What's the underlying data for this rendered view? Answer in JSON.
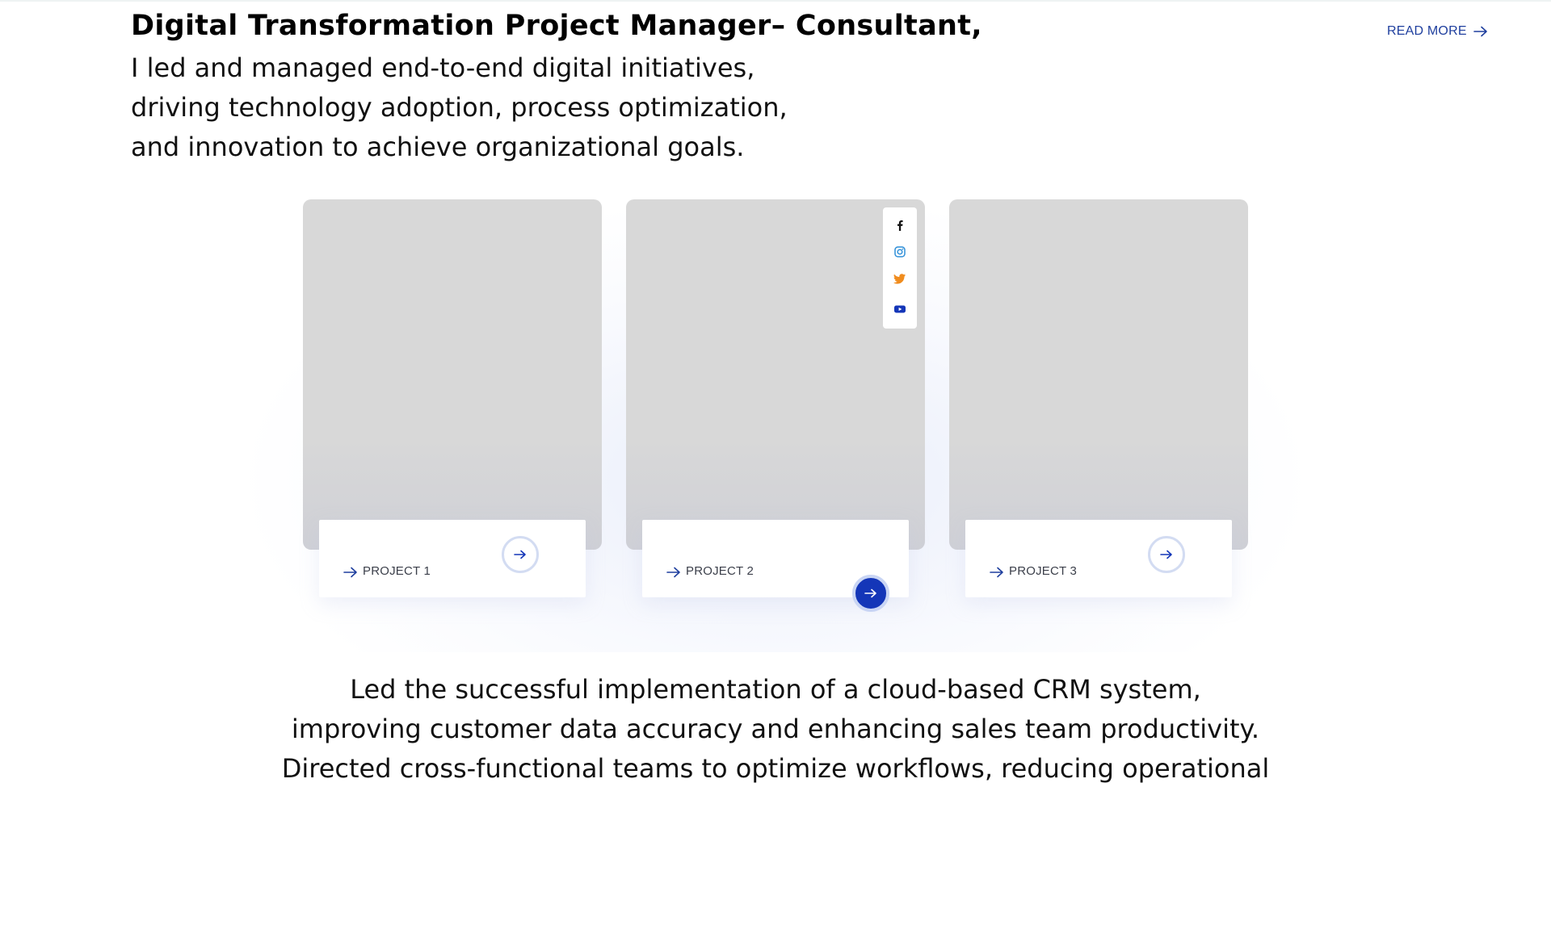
{
  "intro": {
    "title": "Digital Transformation Project Manager– Consultant,",
    "lines": [
      "I led and managed end-to-end digital initiatives,",
      "driving technology adoption, process optimization,",
      "and innovation to achieve organizational goals."
    ]
  },
  "read_more": {
    "label": "READ MORE",
    "icon": "arrow-right-icon"
  },
  "projects": [
    {
      "label": "PROJECT 1",
      "icon": "arrow-right-icon"
    },
    {
      "label": "PROJECT 2",
      "icon": "arrow-right-icon"
    },
    {
      "label": "PROJECT 3",
      "icon": "arrow-right-icon"
    }
  ],
  "social": [
    {
      "name": "facebook-icon",
      "color": "#111111"
    },
    {
      "name": "instagram-icon",
      "color": "#2f8fd8"
    },
    {
      "name": "twitter-icon",
      "color": "#f08c1e"
    },
    {
      "name": "youtube-icon",
      "color": "#1436b8"
    }
  ],
  "description": {
    "lines": [
      "Led the successful implementation of a cloud-based CRM system,",
      "improving customer data accuracy and enhancing sales team productivity.",
      "Directed cross-functional teams to optimize workflows, reducing operational"
    ]
  },
  "colors": {
    "accent": "#1436b8",
    "link": "#1f3f9e",
    "placeholder": "#d8d8d8"
  }
}
